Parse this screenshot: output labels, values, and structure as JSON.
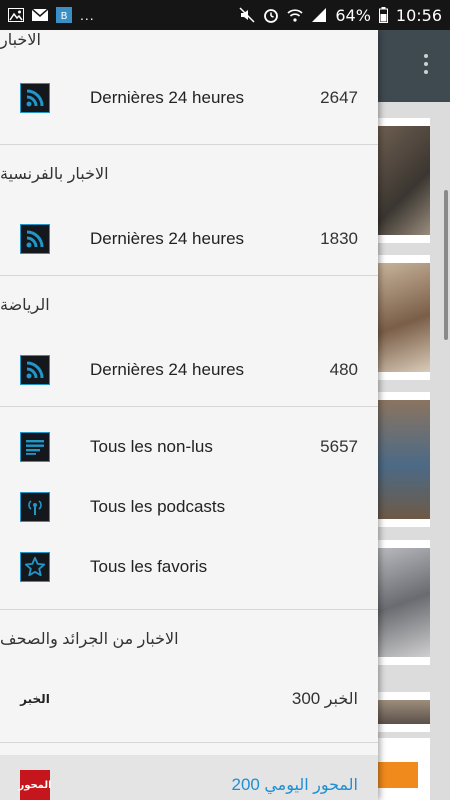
{
  "status_bar": {
    "overflow": "...",
    "battery": "64%",
    "time": "10:56",
    "app_badge": "B"
  },
  "drawer": {
    "groups": [
      {
        "header": "الاخبار",
        "item": {
          "label": "Dernières 24 heures",
          "count": "2647",
          "icon": "rss-icon"
        }
      },
      {
        "header": "الاخبار بالفرنسية",
        "item": {
          "label": "Dernières 24 heures",
          "count": "1830",
          "icon": "rss-icon"
        }
      },
      {
        "header": "الرياضة",
        "item": {
          "label": "Dernières 24 heures",
          "count": "480",
          "icon": "rss-icon"
        }
      }
    ],
    "general": [
      {
        "label": "Tous les non-lus",
        "count": "5657",
        "icon": "list-icon"
      },
      {
        "label": "Tous les podcasts",
        "count": "",
        "icon": "podcast-icon"
      },
      {
        "label": "Tous les favoris",
        "count": "",
        "icon": "star-icon"
      }
    ],
    "papers_header": "الاخبار من الجرائد والصحف",
    "papers": [
      {
        "name": "الخبر",
        "count": "300",
        "logo": "الخبر",
        "active": false
      },
      {
        "name": "المحور اليومي",
        "count": "200",
        "logo": "المحور",
        "active": true
      }
    ]
  },
  "colors": {
    "accent": "#1f8fd3",
    "icon_border": "#2196c8",
    "status_bar": "#151515",
    "toolbar": "#3f4a50"
  }
}
